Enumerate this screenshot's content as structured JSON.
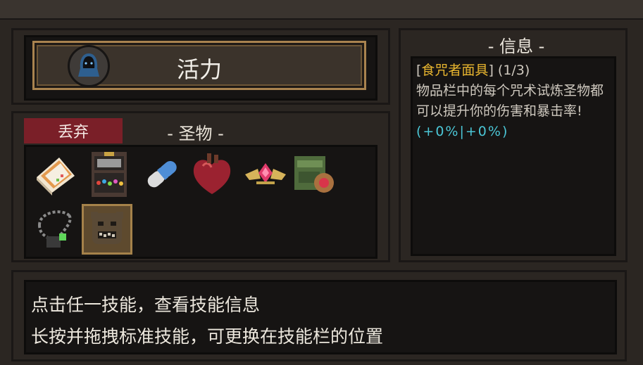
{
  "skill": {
    "name": "活力",
    "avatar_icon": "hooded-figure-icon"
  },
  "relics": {
    "discard_label": "丢弃",
    "title": "- 圣物 -",
    "items": [
      {
        "name": "cake-slice-icon"
      },
      {
        "name": "gem-chest-icon"
      },
      {
        "name": "capsule-icon"
      },
      {
        "name": "heart-icon"
      },
      {
        "name": "winged-gem-icon"
      },
      {
        "name": "green-pack-icon"
      },
      {
        "name": "amulet-icon"
      },
      {
        "name": "spell-eater-mask-icon",
        "selected": true
      }
    ]
  },
  "info": {
    "title": "- 信息 -",
    "bracket_open": "[",
    "relic_name": "食咒者面具",
    "bracket_close": "]",
    "count": "(1/3)",
    "description": "物品栏中的每个咒术试炼圣物都可以提升你的伤害和暴击率!",
    "bonus": "(+0%|+0%)",
    "colors": {
      "relic_name": "#e9b62f",
      "bonus": "#4bc6d6"
    }
  },
  "hints": [
    "点击任一技能，查看技能信息",
    "长按并拖拽标准技能，可更换在技能栏的位置"
  ],
  "colors": {
    "discard_button": "#7a1f28",
    "gold_border": "#a9834f",
    "panel": "#161413"
  }
}
